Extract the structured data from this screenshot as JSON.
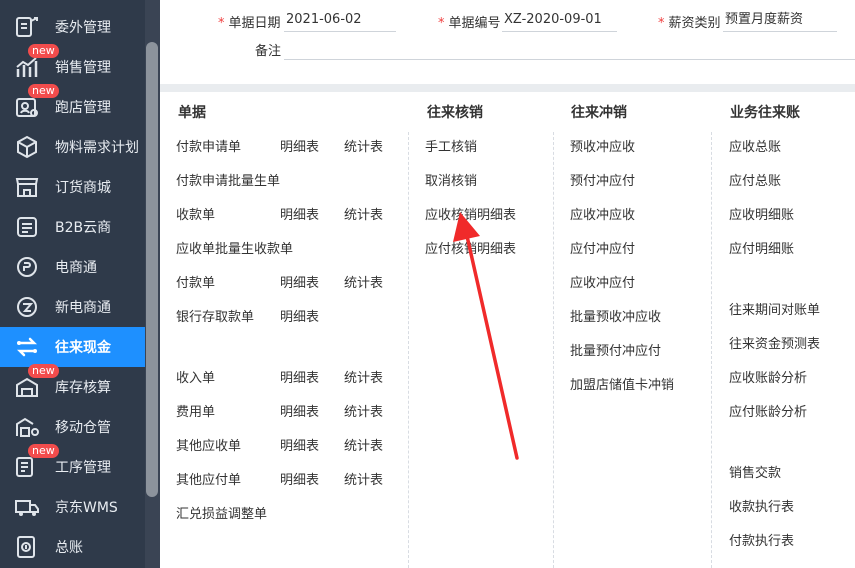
{
  "sidebar": {
    "items": [
      {
        "label": "委外管理",
        "icon": "outsource-icon",
        "new": false
      },
      {
        "label": "销售管理",
        "icon": "sales-chart-icon",
        "new": true
      },
      {
        "label": "跑店管理",
        "icon": "store-visit-icon",
        "new": true
      },
      {
        "label": "物料需求计划",
        "icon": "cube-icon",
        "new": false
      },
      {
        "label": "订货商城",
        "icon": "shop-icon",
        "new": false
      },
      {
        "label": "B2B云商",
        "icon": "cloud-store-icon",
        "new": false
      },
      {
        "label": "电商通",
        "icon": "ecommerce-icon",
        "new": false
      },
      {
        "label": "新电商通",
        "icon": "new-ecommerce-icon",
        "new": false
      },
      {
        "label": "往来现金",
        "icon": "exchange-icon",
        "new": false,
        "active": true
      },
      {
        "label": "库存核算",
        "icon": "inventory-icon",
        "new": true
      },
      {
        "label": "移动仓管",
        "icon": "mobile-warehouse-icon",
        "new": false
      },
      {
        "label": "工序管理",
        "icon": "process-icon",
        "new": true
      },
      {
        "label": "京东WMS",
        "icon": "truck-icon",
        "new": false
      },
      {
        "label": "总账",
        "icon": "ledger-icon",
        "new": false
      }
    ],
    "badge_text": "new"
  },
  "form": {
    "date_label": "单据日期",
    "date_value": "2021-06-02",
    "number_label": "单据编号",
    "number_value": "XZ-2020-09-01",
    "salary_label": "薪资类别",
    "salary_value": "预置月度薪资",
    "remark_label": "备注",
    "remark_value": ""
  },
  "menu": {
    "col1_title": "单据",
    "col2_title": "往来核销",
    "col3_title": "往来冲销",
    "col4_title": "业务往来账",
    "detail_label": "明细表",
    "stats_label": "统计表",
    "col1": [
      "付款申请单",
      "付款申请批量生单",
      "收款单",
      "应收单批量生收款单",
      "付款单",
      "银行存取款单",
      "收入单",
      "费用单",
      "其他应收单",
      "其他应付单",
      "汇兑损益调整单"
    ],
    "col2": [
      "手工核销",
      "取消核销",
      "应收核销明细表",
      "应付核销明细表"
    ],
    "col3": [
      "预收冲应收",
      "预付冲应付",
      "应收冲应收",
      "应付冲应付",
      "应收冲应付",
      "批量预收冲应收",
      "批量预付冲应付",
      "加盟店储值卡冲销"
    ],
    "col4": [
      "应收总账",
      "应付总账",
      "应收明细账",
      "应付明细账",
      "往来期间对账单",
      "往来资金预测表",
      "应收账龄分析",
      "应付账龄分析",
      "销售交款",
      "收款执行表",
      "付款执行表"
    ]
  },
  "colors": {
    "sidebar_bg": "#2f3a4a",
    "active_bg": "#1e90ff",
    "badge_bg": "#f24c4c",
    "arrow": "#f02a2a",
    "required_star": "#f04040"
  }
}
